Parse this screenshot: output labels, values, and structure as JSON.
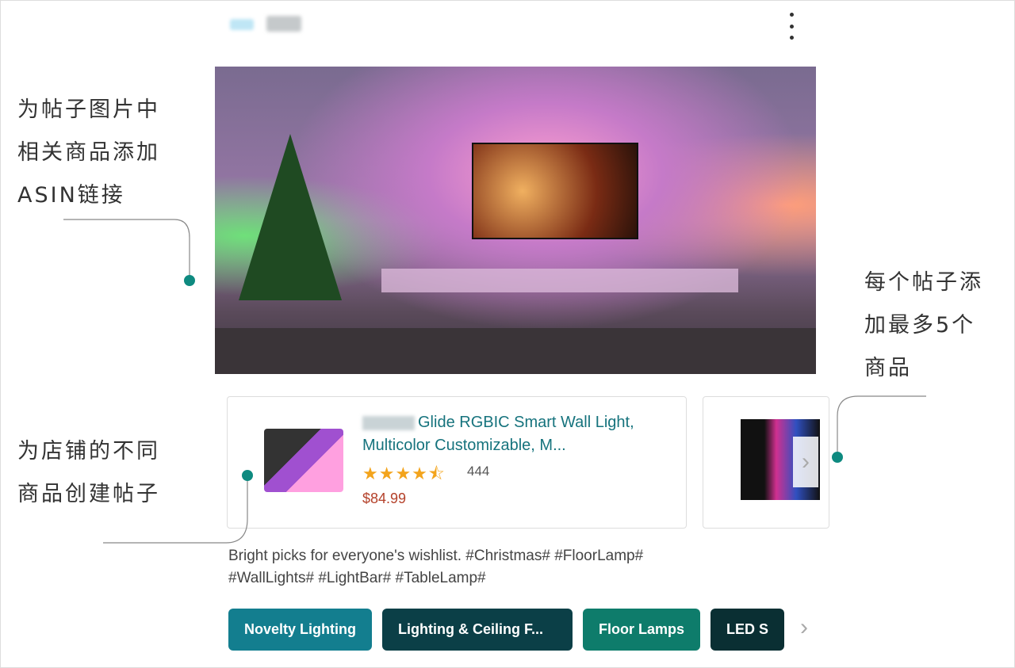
{
  "post": {
    "more_icon": "kebab-menu-icon",
    "products": [
      {
        "title": "Glide RGBIC Smart Wall Light, Multicolor Customizable, M...",
        "rating": 4.5,
        "rating_stars": "★★★★⯪",
        "review_count": "444",
        "price": "$84.99"
      }
    ],
    "caption_line1": "Bright picks for everyone's wishlist. #Christmas# #FloorLamp#",
    "caption_line2": "#WallLights# #LightBar# #TableLamp#",
    "categories": [
      {
        "label": "Novelty Lighting",
        "color": "#137e8f"
      },
      {
        "label": "Lighting & Ceiling F...",
        "color": "#0b3f47"
      },
      {
        "label": "Floor Lamps",
        "color": "#0e7c6b"
      },
      {
        "label": "LED S",
        "color": "#0a2f33"
      }
    ]
  },
  "annotations": {
    "asin_link": [
      "为帖子图片中",
      "相关商品添加",
      "ASIN链接"
    ],
    "max_products": [
      "每个帖子添",
      "加最多5个",
      "商品"
    ],
    "per_product": [
      "为店铺的不同",
      "商品创建帖子"
    ]
  },
  "colors": {
    "accent_dot": "#0e8a80",
    "link": "#16737d",
    "price": "#b4412a",
    "star": "#f3a41c"
  }
}
